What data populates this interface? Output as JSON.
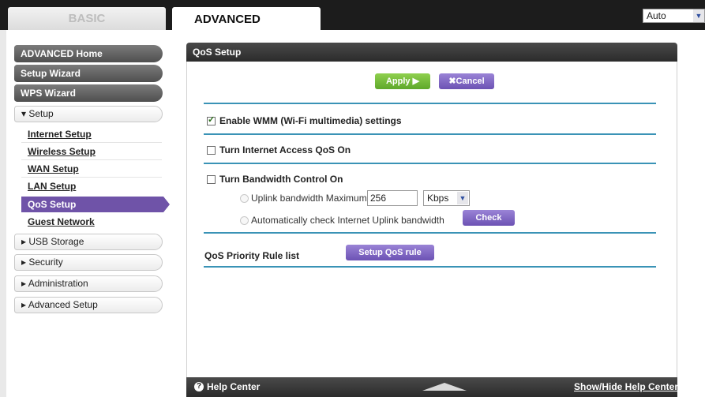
{
  "tabs": {
    "basic": "BASIC",
    "advanced": "ADVANCED"
  },
  "language_select": {
    "value": "Auto"
  },
  "sidebar": {
    "advanced_home": "ADVANCED Home",
    "setup_wizard": "Setup Wizard",
    "wps_wizard": "WPS Wizard",
    "setup_header": "▾ Setup",
    "setup_items": [
      "Internet Setup",
      "Wireless Setup",
      "WAN Setup",
      "LAN Setup",
      "QoS Setup",
      "Guest Network"
    ],
    "sections": [
      "▸ USB Storage",
      "▸ Security",
      "▸ Administration",
      "▸ Advanced Setup"
    ]
  },
  "panel": {
    "title": "QoS Setup",
    "apply": "Apply ▶",
    "cancel": "✖Cancel",
    "wmm_label": "Enable WMM (Wi-Fi multimedia) settings",
    "wmm_checked": true,
    "internet_qos_label": "Turn Internet Access QoS On",
    "bandwidth_label": "Turn Bandwidth Control On",
    "uplink_label": "Uplink bandwidth Maximum",
    "uplink_value": "256",
    "uplink_unit": "Kbps",
    "auto_check_label": "Automatically check Internet Uplink bandwidth",
    "check_button": "Check",
    "priority_label": "QoS Priority Rule list",
    "setup_rule_button": "Setup QoS rule"
  },
  "footer": {
    "help_center": "Help Center",
    "toggle": "Show/Hide Help Center"
  },
  "colors": {
    "accent_purple": "#6f53a8",
    "apply_green": "#6cb634",
    "rule_blue": "#3a93b6"
  }
}
